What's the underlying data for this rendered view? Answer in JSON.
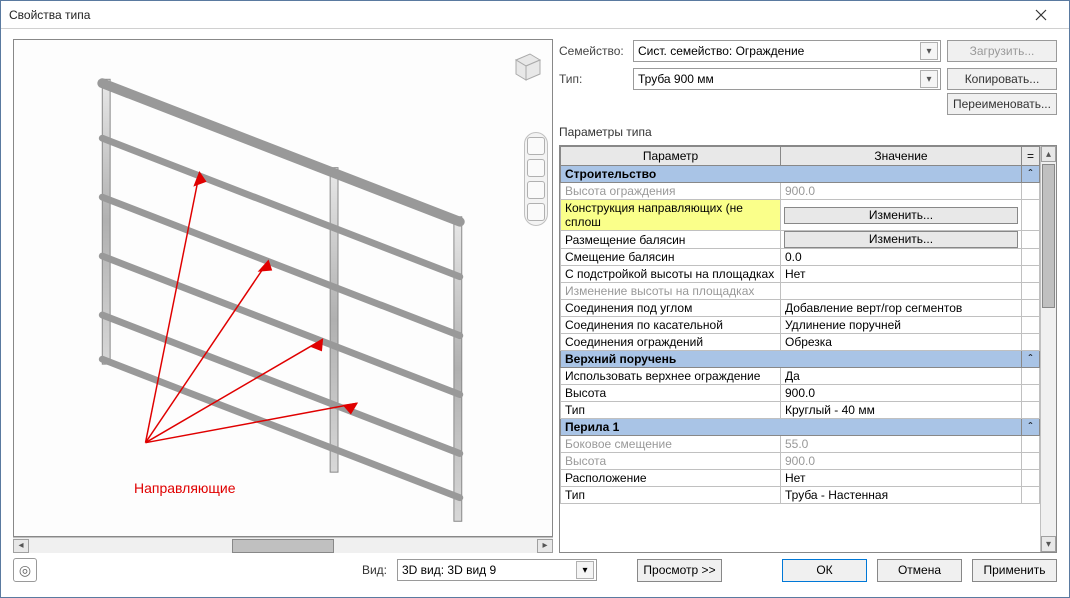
{
  "window": {
    "title": "Свойства типа"
  },
  "form": {
    "family_label": "Семейство:",
    "family_value": "Сист. семейство: Ограждение",
    "type_label": "Тип:",
    "type_value": "Труба 900 мм",
    "load_btn": "Загрузить...",
    "copy_btn": "Копировать...",
    "rename_btn": "Переименовать..."
  },
  "params_label": "Параметры типа",
  "grid": {
    "col_param": "Параметр",
    "col_value": "Значение",
    "col_eq": "=",
    "edit_btn": "Изменить...",
    "groups": [
      {
        "name": "Строительство",
        "rows": [
          {
            "p": "Высота ограждения",
            "v": "900.0",
            "disabled": true
          },
          {
            "p": "Конструкция направляющих (не сплош",
            "v_btn": true,
            "hl": true
          },
          {
            "p": "Размещение балясин",
            "v_btn": true
          },
          {
            "p": "Смещение балясин",
            "v": "0.0"
          },
          {
            "p": "С подстройкой высоты на площадках",
            "v": "Нет"
          },
          {
            "p": "Изменение высоты на площадках",
            "v": "",
            "disabled": true
          },
          {
            "p": "Соединения под углом",
            "v": "Добавление верт/гор сегментов"
          },
          {
            "p": "Соединения по касательной",
            "v": "Удлинение поручней"
          },
          {
            "p": "Соединения ограждений",
            "v": "Обрезка"
          }
        ]
      },
      {
        "name": "Верхний поручень",
        "rows": [
          {
            "p": "Использовать верхнее ограждение",
            "v": "Да"
          },
          {
            "p": "Высота",
            "v": "900.0"
          },
          {
            "p": "Тип",
            "v": "Круглый - 40 мм"
          }
        ]
      },
      {
        "name": "Перила 1",
        "rows": [
          {
            "p": "Боковое смещение",
            "v": "55.0",
            "disabled": true
          },
          {
            "p": "Высота",
            "v": "900.0",
            "disabled": true
          },
          {
            "p": "Расположение",
            "v": "Нет"
          },
          {
            "p": "Тип",
            "v": "Труба - Настенная"
          }
        ]
      }
    ]
  },
  "preview": {
    "annotation": "Направляющие"
  },
  "footer": {
    "view_label": "Вид:",
    "view_value": "3D вид: 3D вид 9",
    "preview_toggle": "Просмотр >>",
    "ok": "ОК",
    "cancel": "Отмена",
    "apply": "Применить"
  }
}
